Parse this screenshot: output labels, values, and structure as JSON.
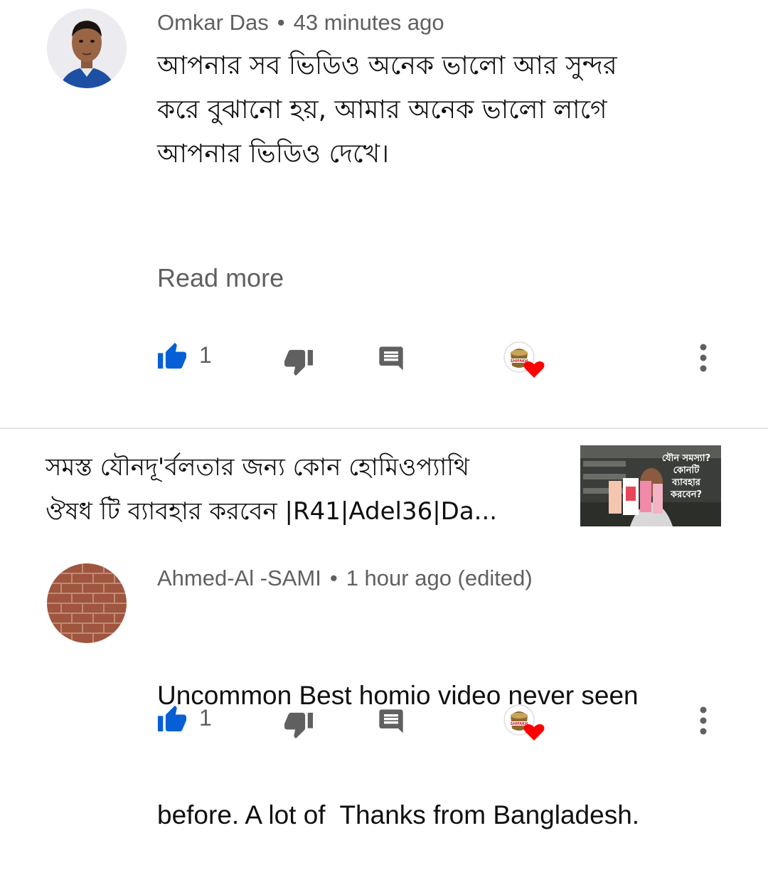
{
  "comments": [
    {
      "author": "Omkar Das",
      "time": "43 minutes ago",
      "body_lines": [
        "আপনার সব ভিডিও অনেক ভালো আর সুন্দর",
        "করে বুঝানো হয়, আমার অনেক ভালো লাগে",
        "আপনার ভিডিও দেখে।"
      ],
      "read_more": "Read more",
      "likes": "1",
      "creator_badge_text": "SHIFAKH"
    },
    {
      "author": "Ahmed-Al -SAMI",
      "time": "1 hour ago (edited)",
      "body_lines": [
        "Uncommon Best homio video never seen",
        "before. A lot of  Thanks from Bangladesh."
      ],
      "likes": "1",
      "creator_badge_text": "SHIFAKH"
    }
  ],
  "video": {
    "title_lines": [
      "সমস্ত যৌনদূ'র্বলতার জন্য কোন হোমিওপ্যাথি",
      "ঔষধ টি ব্যাবহার করবেন |R41|Adel36|Da..."
    ],
    "thumbnail_text": [
      "যৌন সমস্যা?",
      "কোনটি",
      "ব্যাবহার",
      "করবেন?"
    ]
  },
  "colors": {
    "like_active": "#065fd4",
    "icon_gray": "#606060",
    "heart": "#ff0000",
    "divider": "#e5e5e5"
  },
  "icons": [
    "thumbs-up-icon",
    "thumbs-down-icon",
    "reply-icon",
    "creator-heart-icon",
    "more-vert-icon"
  ]
}
